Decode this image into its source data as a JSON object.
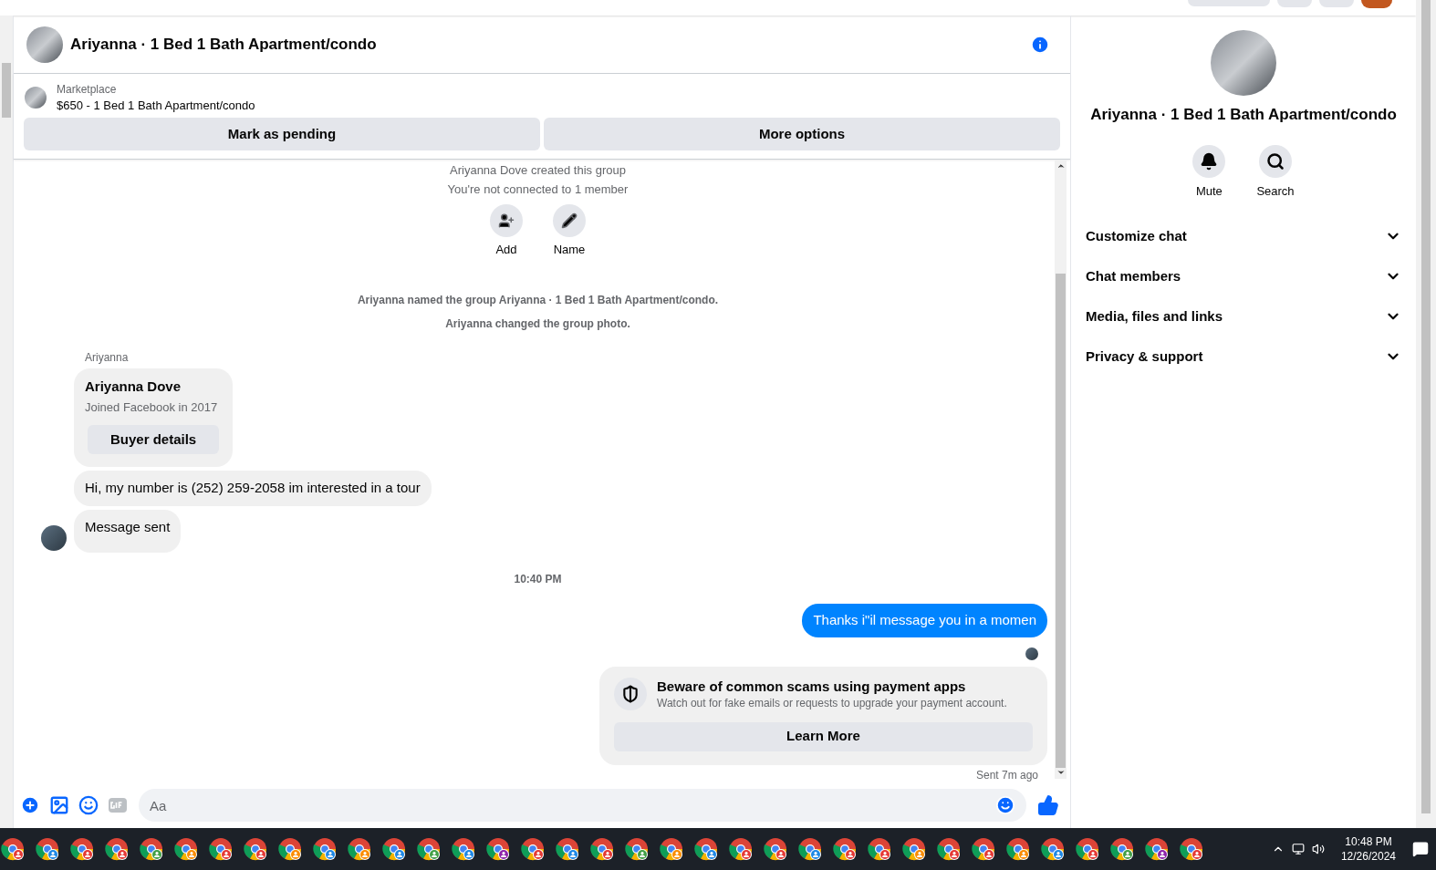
{
  "chat_header": {
    "title": "Ariyanna · 1 Bed 1 Bath Apartment/condo"
  },
  "listing": {
    "source": "Marketplace",
    "title": "$650 - 1 Bed 1 Bath Apartment/condo",
    "buttons": [
      "Mark as pending",
      "More options"
    ]
  },
  "group_intro": {
    "lines": [
      "Ariyanna Dove created this group",
      "You're not connected to 1 member"
    ],
    "actions": [
      {
        "kind": "add",
        "label": "Add"
      },
      {
        "kind": "name",
        "label": "Name"
      }
    ]
  },
  "events": [
    "Ariyanna named the group Ariyanna · 1 Bed 1 Bath Apartment/condo.",
    "Ariyanna changed the group photo."
  ],
  "incoming": {
    "sender": "Ariyanna",
    "card": {
      "name": "Ariyanna Dove",
      "subtitle": "Joined Facebook in 2017",
      "button": "Buyer details"
    },
    "messages": [
      "Hi, my number is (252) 259-2058 im interested in a tour",
      "Message sent"
    ]
  },
  "timestamp": "10:40 PM",
  "outgoing": {
    "text": "Thanks i\"il message you in a momen"
  },
  "notice": {
    "title": "Beware of common scams using payment apps",
    "body": "Watch out for fake emails or requests to upgrade your payment account.",
    "button": "Learn More",
    "status": "Sent 7m ago"
  },
  "composer": {
    "placeholder": "Aa"
  },
  "info_panel": {
    "title": "Ariyanna · 1 Bed 1 Bath Apartment/condo",
    "actions": [
      {
        "kind": "mute",
        "label": "Mute"
      },
      {
        "kind": "search",
        "label": "Search"
      }
    ],
    "sections": [
      {
        "label": "Customize chat",
        "expanded": false
      },
      {
        "label": "Chat members",
        "expanded": false
      },
      {
        "label": "Media, files and links",
        "expanded": false
      },
      {
        "label": "Privacy & support",
        "expanded": false
      }
    ]
  },
  "taskbar": {
    "time": "10:48 PM",
    "date": "12/26/2024"
  }
}
